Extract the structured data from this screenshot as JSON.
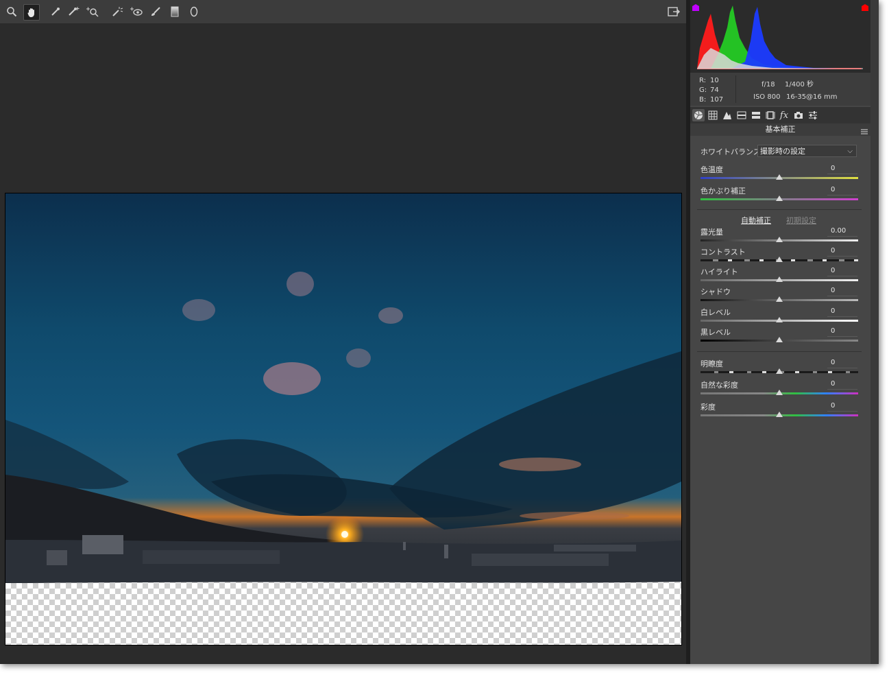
{
  "toolbar": {
    "tools": [
      "zoom-tool",
      "hand-tool",
      "white-balance-tool",
      "color-sampler-tool",
      "targeted-adjustment-tool",
      "spot-removal-tool",
      "red-eye-tool",
      "adjustment-brush-tool",
      "graduated-filter-tool",
      "radial-filter-tool"
    ],
    "active_tool": "hand-tool"
  },
  "readout": {
    "r_label": "R:",
    "r_value": "10",
    "g_label": "G:",
    "g_value": "74",
    "b_label": "B:",
    "b_value": "107",
    "aperture": "f/18",
    "shutter": "1/400 秒",
    "iso": "ISO 800",
    "lens": "16-35@16 mm"
  },
  "panel": {
    "title": "基本補正",
    "white_balance_label": "ホワイトバランス :",
    "white_balance_value": "撮影時の設定",
    "auto_link": "自動補正",
    "default_link": "初期設定",
    "sliders": [
      {
        "label": "色温度",
        "value": "0"
      },
      {
        "label": "色かぶり補正",
        "value": "0"
      },
      {
        "label": "露光量",
        "value": "0.00"
      },
      {
        "label": "コントラスト",
        "value": "0"
      },
      {
        "label": "ハイライト",
        "value": "0"
      },
      {
        "label": "シャドウ",
        "value": "0"
      },
      {
        "label": "白レベル",
        "value": "0"
      },
      {
        "label": "黒レベル",
        "value": "0"
      },
      {
        "label": "明瞭度",
        "value": "0"
      },
      {
        "label": "自然な彩度",
        "value": "0"
      },
      {
        "label": "彩度",
        "value": "0"
      }
    ]
  },
  "colors": {
    "panel_bg": "#464646",
    "canvas_bg": "#2b2b2b",
    "clip_shadow": "#c000ff",
    "clip_highlight": "#ff0000"
  }
}
